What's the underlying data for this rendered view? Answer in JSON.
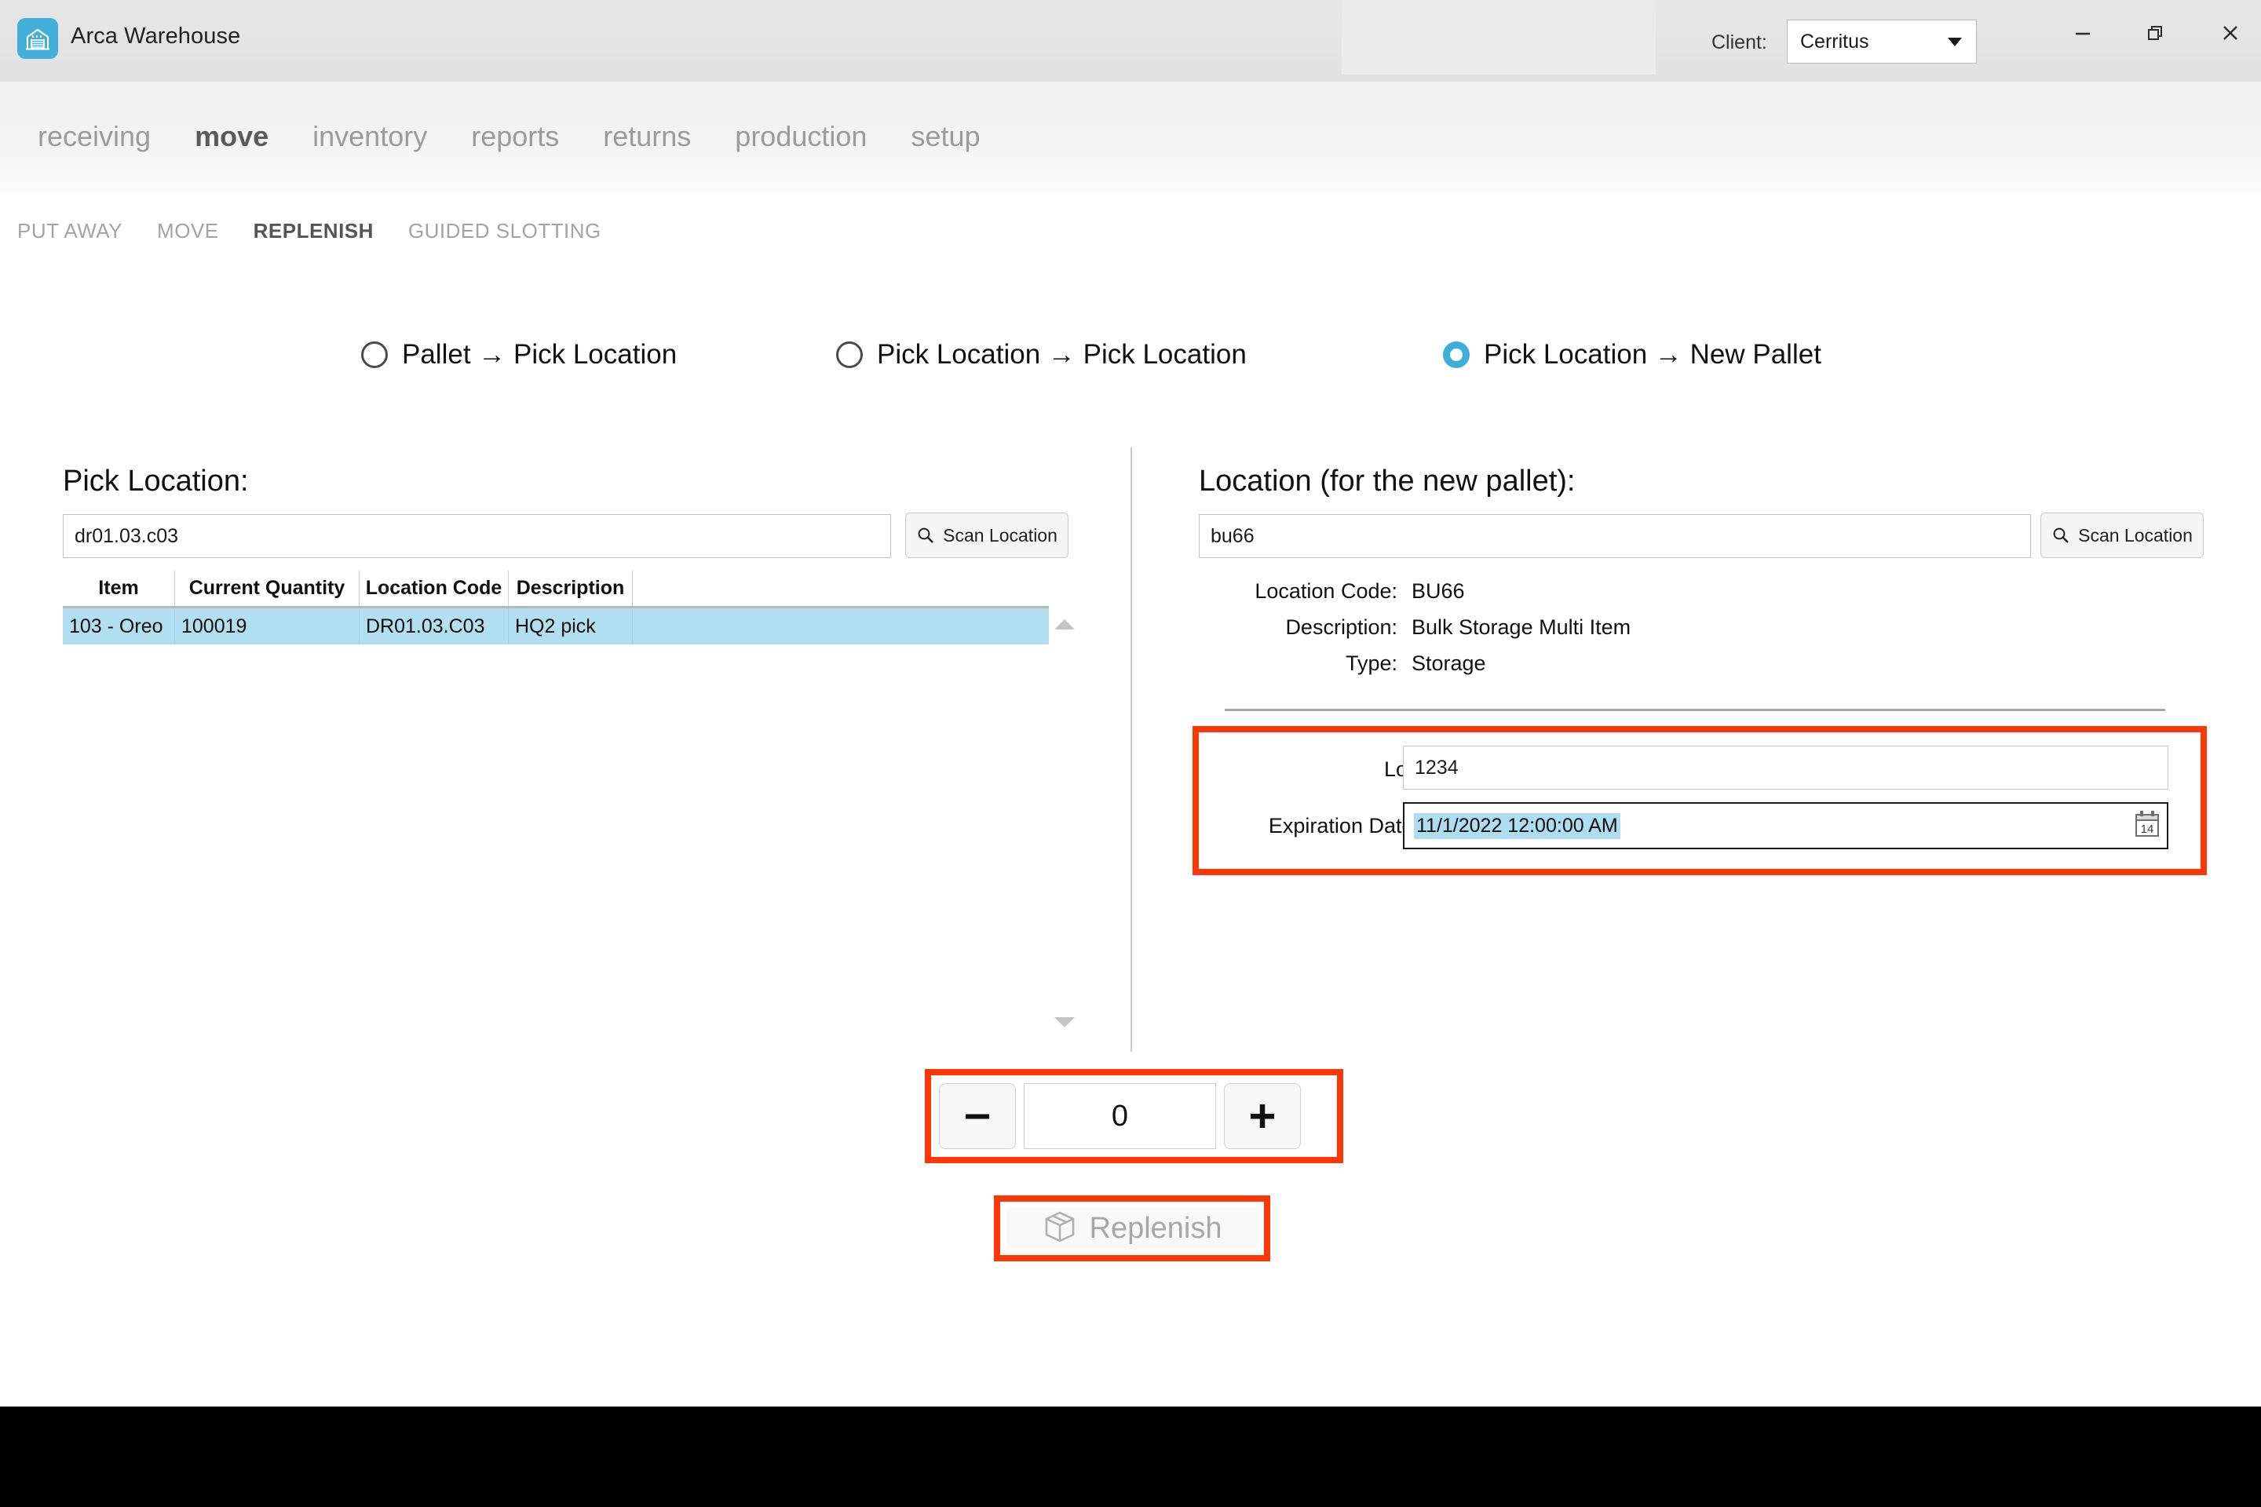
{
  "window": {
    "app_title": "Arca Warehouse",
    "app_icon": "warehouse-icon",
    "client_label": "Client:",
    "client_value": "Cerritus",
    "minimize": "minimize-icon",
    "maximize": "restore-icon",
    "close": "close-icon"
  },
  "main_nav": {
    "items": [
      {
        "label": "receiving",
        "active": false
      },
      {
        "label": "move",
        "active": true
      },
      {
        "label": "inventory",
        "active": false
      },
      {
        "label": "reports",
        "active": false
      },
      {
        "label": "returns",
        "active": false
      },
      {
        "label": "production",
        "active": false
      },
      {
        "label": "setup",
        "active": false
      }
    ]
  },
  "sub_nav": {
    "items": [
      {
        "label": "PUT AWAY",
        "active": false
      },
      {
        "label": "MOVE",
        "active": false
      },
      {
        "label": "REPLENISH",
        "active": true
      },
      {
        "label": "GUIDED SLOTTING",
        "active": false
      }
    ]
  },
  "mode_radios": [
    {
      "label": "Pallet → Pick Location",
      "checked": false
    },
    {
      "label": "Pick Location → Pick Location",
      "checked": false
    },
    {
      "label": "Pick Location → New Pallet",
      "checked": true
    }
  ],
  "left_panel": {
    "heading": "Pick Location:",
    "location_value": "dr01.03.c03",
    "scan_button": "Scan Location",
    "table": {
      "columns": [
        "Item",
        "Current Quantity",
        "Location Code",
        "Description",
        ""
      ],
      "rows": [
        {
          "item": "103 - Oreo",
          "current_quantity": "100019",
          "location_code": "DR01.03.C03",
          "description": "HQ2 pick",
          "extra": "",
          "selected": true
        }
      ]
    }
  },
  "right_panel": {
    "heading": "Location (for the new pallet):",
    "location_value": "bu66",
    "scan_button": "Scan Location",
    "details": [
      {
        "label": "Location Code:",
        "value": "BU66"
      },
      {
        "label": "Description:",
        "value": "Bulk Storage Multi Item"
      },
      {
        "label": "Type:",
        "value": "Storage"
      }
    ],
    "lot": {
      "label": "Lot:",
      "value": "1234"
    },
    "expiration": {
      "label": "Expiration Date:",
      "value": "11/1/2022 12:00:00 AM",
      "calendar_day": "14"
    }
  },
  "stepper": {
    "decrement": "−",
    "value": "0",
    "increment": "+"
  },
  "action": {
    "replenish_label": "Replenish",
    "replenish_icon": "box-icon",
    "enabled": false
  },
  "colors": {
    "accent_blue": "#3fadda",
    "highlight_red": "#fa3807",
    "row_selected": "#b2dff0",
    "text_selection": "#aedcf0",
    "disabled_text": "#a7a7a7"
  }
}
